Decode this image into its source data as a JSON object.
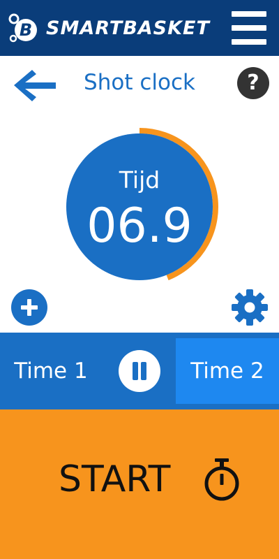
{
  "header": {
    "brand": "SMARTBASKET",
    "logo_letter": "B",
    "icons": {
      "logo": "smartbasket-logo-icon",
      "menu": "hamburger-menu-icon"
    }
  },
  "toolbar": {
    "title": "Shot clock",
    "help_label": "?",
    "icons": {
      "back": "arrow-left-icon",
      "help": "question-mark-icon"
    }
  },
  "clock": {
    "label": "Tijd",
    "time": "06.9",
    "remaining_fraction": 0.44,
    "colors": {
      "face": "#1a6fc4",
      "progress": "#f7941d",
      "track": "#ffffff"
    }
  },
  "controls": {
    "icons": {
      "add": "plus-icon",
      "settings": "gear-icon"
    }
  },
  "periods": {
    "items": [
      {
        "label": "Time 1",
        "selected": false
      },
      {
        "label": "Time 2",
        "selected": true
      }
    ],
    "icons": {
      "pause": "pause-icon"
    }
  },
  "start": {
    "label": "START",
    "icons": {
      "stopwatch": "stopwatch-icon"
    }
  },
  "colors": {
    "header_bg": "#0a3d7a",
    "accent_blue": "#1a6fc4",
    "selected_tab": "#1e88f0",
    "start_orange": "#f7941d"
  }
}
